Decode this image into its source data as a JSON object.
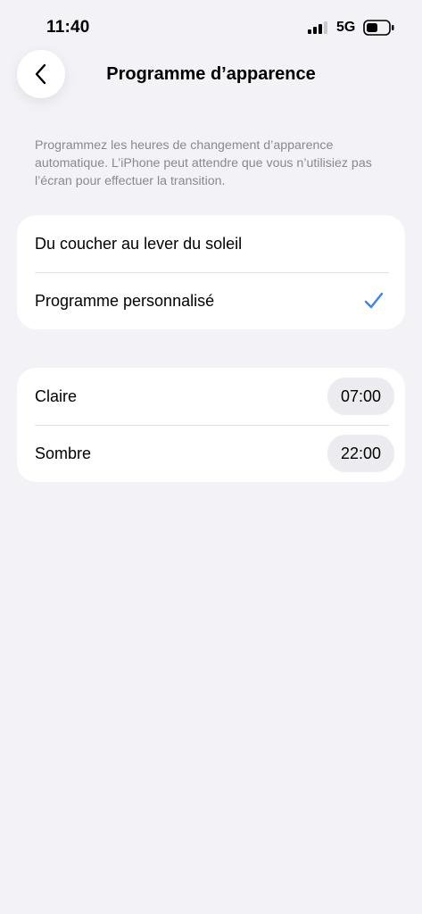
{
  "status_bar": {
    "time": "11:40",
    "network": "5G",
    "icons": [
      "signal-bars-icon",
      "battery-icon"
    ]
  },
  "nav": {
    "back_icon": "chevron-left-icon",
    "title": "Programme d’apparence"
  },
  "description": "Programmez les heures de changement d’apparence automatique. L’iPhone peut attendre que vous n’utilisiez pas l’écran pour effectuer la transition.",
  "schedule_options": [
    {
      "label": "Du coucher au lever du soleil",
      "selected": false
    },
    {
      "label": "Programme personnalisé",
      "selected": true
    }
  ],
  "times": [
    {
      "label": "Claire",
      "value": "07:00"
    },
    {
      "label": "Sombre",
      "value": "22:00"
    }
  ],
  "colors": {
    "background": "#f2f2f7",
    "card": "#ffffff",
    "accent": "#3b82f6",
    "secondary_text": "#8a8a8e",
    "pill": "#ececf0"
  }
}
